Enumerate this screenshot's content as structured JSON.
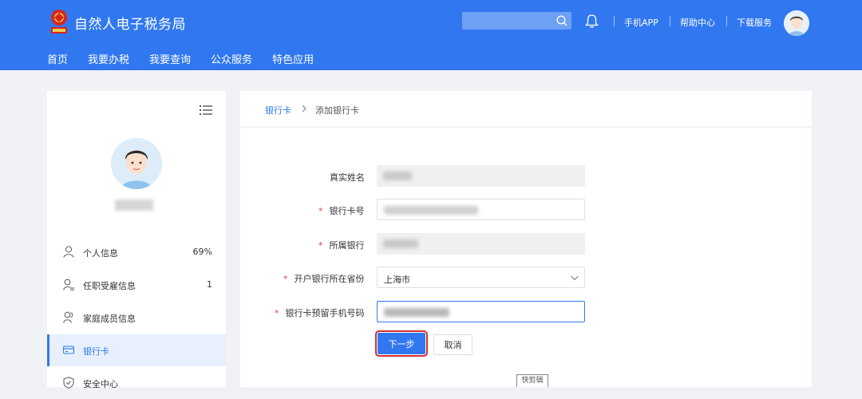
{
  "header": {
    "site_title": "自然人电子税务局",
    "search_placeholder": "",
    "links": [
      "手机APP",
      "帮助中心",
      "下载服务"
    ],
    "nav": [
      "首页",
      "我要办税",
      "我要查询",
      "公众服务",
      "特色应用"
    ],
    "brand_color": "#3178f0"
  },
  "sidebar": {
    "items": [
      {
        "label": "个人信息",
        "value": "69%",
        "icon": "user-icon"
      },
      {
        "label": "任职受雇信息",
        "value": "1",
        "icon": "user-list-icon"
      },
      {
        "label": "家庭成员信息",
        "value": "",
        "icon": "family-icon"
      },
      {
        "label": "银行卡",
        "value": "",
        "icon": "bank-card-icon",
        "active": true
      },
      {
        "label": "安全中心",
        "value": "",
        "icon": "shield-icon"
      }
    ]
  },
  "breadcrumb": {
    "link": "银行卡",
    "current": "添加银行卡"
  },
  "form": {
    "name_label": "真实姓名",
    "card_label": "银行卡号",
    "bank_label": "所属银行",
    "province_label": "开户银行所在省份",
    "province_value": "上海市",
    "phone_label": "银行卡预留手机号码",
    "required_mark": "*",
    "next_button": "下一步",
    "cancel_button": "取消"
  },
  "floating_tag": "快剪辑"
}
